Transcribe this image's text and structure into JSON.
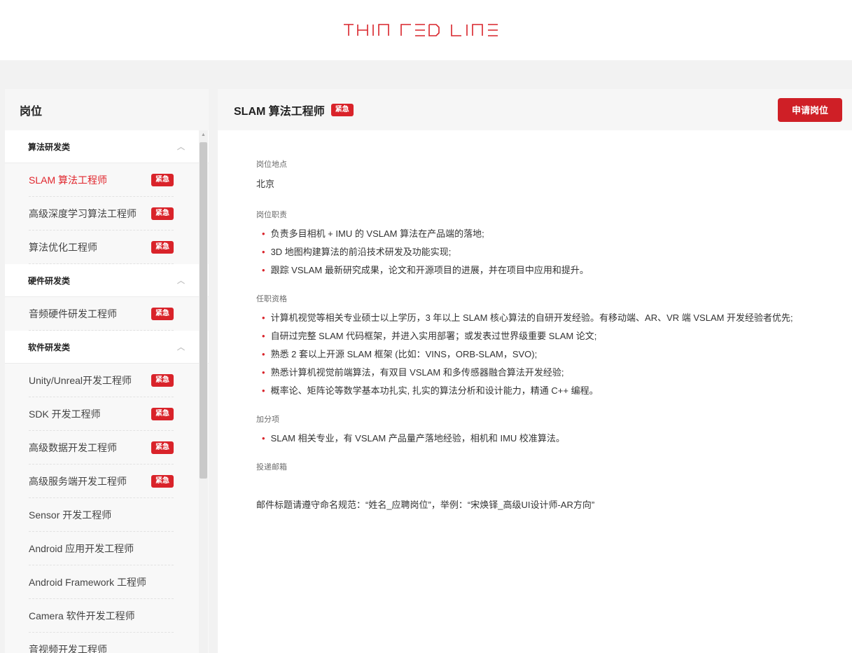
{
  "brand": {
    "logo_text": "THIN RED LINE",
    "logo_color": "#d9232a"
  },
  "sidebar": {
    "title": "岗位",
    "groups": [
      {
        "name": "算法研发类",
        "jobs": [
          {
            "label": "SLAM 算法工程师",
            "badge": "紧急",
            "active": true
          },
          {
            "label": "高级深度学习算法工程师",
            "badge": "紧急"
          },
          {
            "label": "算法优化工程师",
            "badge": "紧急"
          }
        ]
      },
      {
        "name": "硬件研发类",
        "jobs": [
          {
            "label": "音频硬件研发工程师",
            "badge": "紧急"
          }
        ]
      },
      {
        "name": "软件研发类",
        "jobs": [
          {
            "label": "Unity/Unreal开发工程师",
            "badge": "紧急"
          },
          {
            "label": "SDK 开发工程师",
            "badge": "紧急"
          },
          {
            "label": "高级数据开发工程师",
            "badge": "紧急"
          },
          {
            "label": "高级服务端开发工程师",
            "badge": "紧急"
          },
          {
            "label": "Sensor 开发工程师"
          },
          {
            "label": "Android 应用开发工程师"
          },
          {
            "label": "Android Framework 工程师"
          },
          {
            "label": "Camera 软件开发工程师"
          },
          {
            "label": "音视频开发工程师"
          }
        ]
      }
    ]
  },
  "job": {
    "title": "SLAM 算法工程师",
    "badge": "紧急",
    "apply_label": "申请岗位",
    "location_label": "岗位地点",
    "location": "北京",
    "duties_label": "岗位职责",
    "duties": [
      "负责多目相机 + IMU 的 VSLAM 算法在产品端的落地;",
      "3D 地图构建算法的前沿技术研发及功能实现;",
      "跟踪 VSLAM 最新研究成果，论文和开源项目的进展，并在项目中应用和提升。"
    ],
    "requirements_label": "任职资格",
    "requirements": [
      "计算机视觉等相关专业硕士以上学历，3 年以上 SLAM 核心算法的自研开发经验。有移动端、AR、VR 端 VSLAM 开发经验者优先;",
      "自研过完整 SLAM 代码框架，并进入实用部署；或发表过世界级重要 SLAM 论文;",
      "熟悉 2 套以上开源 SLAM 框架 (比如：VINS，ORB-SLAM，SVO);",
      "熟悉计算机视觉前端算法，有双目 VSLAM 和多传感器融合算法开发经验;",
      "概率论、矩阵论等数学基本功扎实, 扎实的算法分析和设计能力，精通 C++ 编程。"
    ],
    "bonus_label": "加分项",
    "bonus": [
      "SLAM 相关专业，有 VSLAM 产品量产落地经验，相机和 IMU 校准算法。"
    ],
    "email_label": "投递邮箱",
    "email_note": "邮件标题请遵守命名规范：“姓名_应聘岗位”，举例：“宋焕铎_高级UI设计师-AR方向”"
  },
  "colors": {
    "accent": "#d9232a",
    "button": "#cf1f26",
    "page_bg": "#f2f2f2"
  }
}
